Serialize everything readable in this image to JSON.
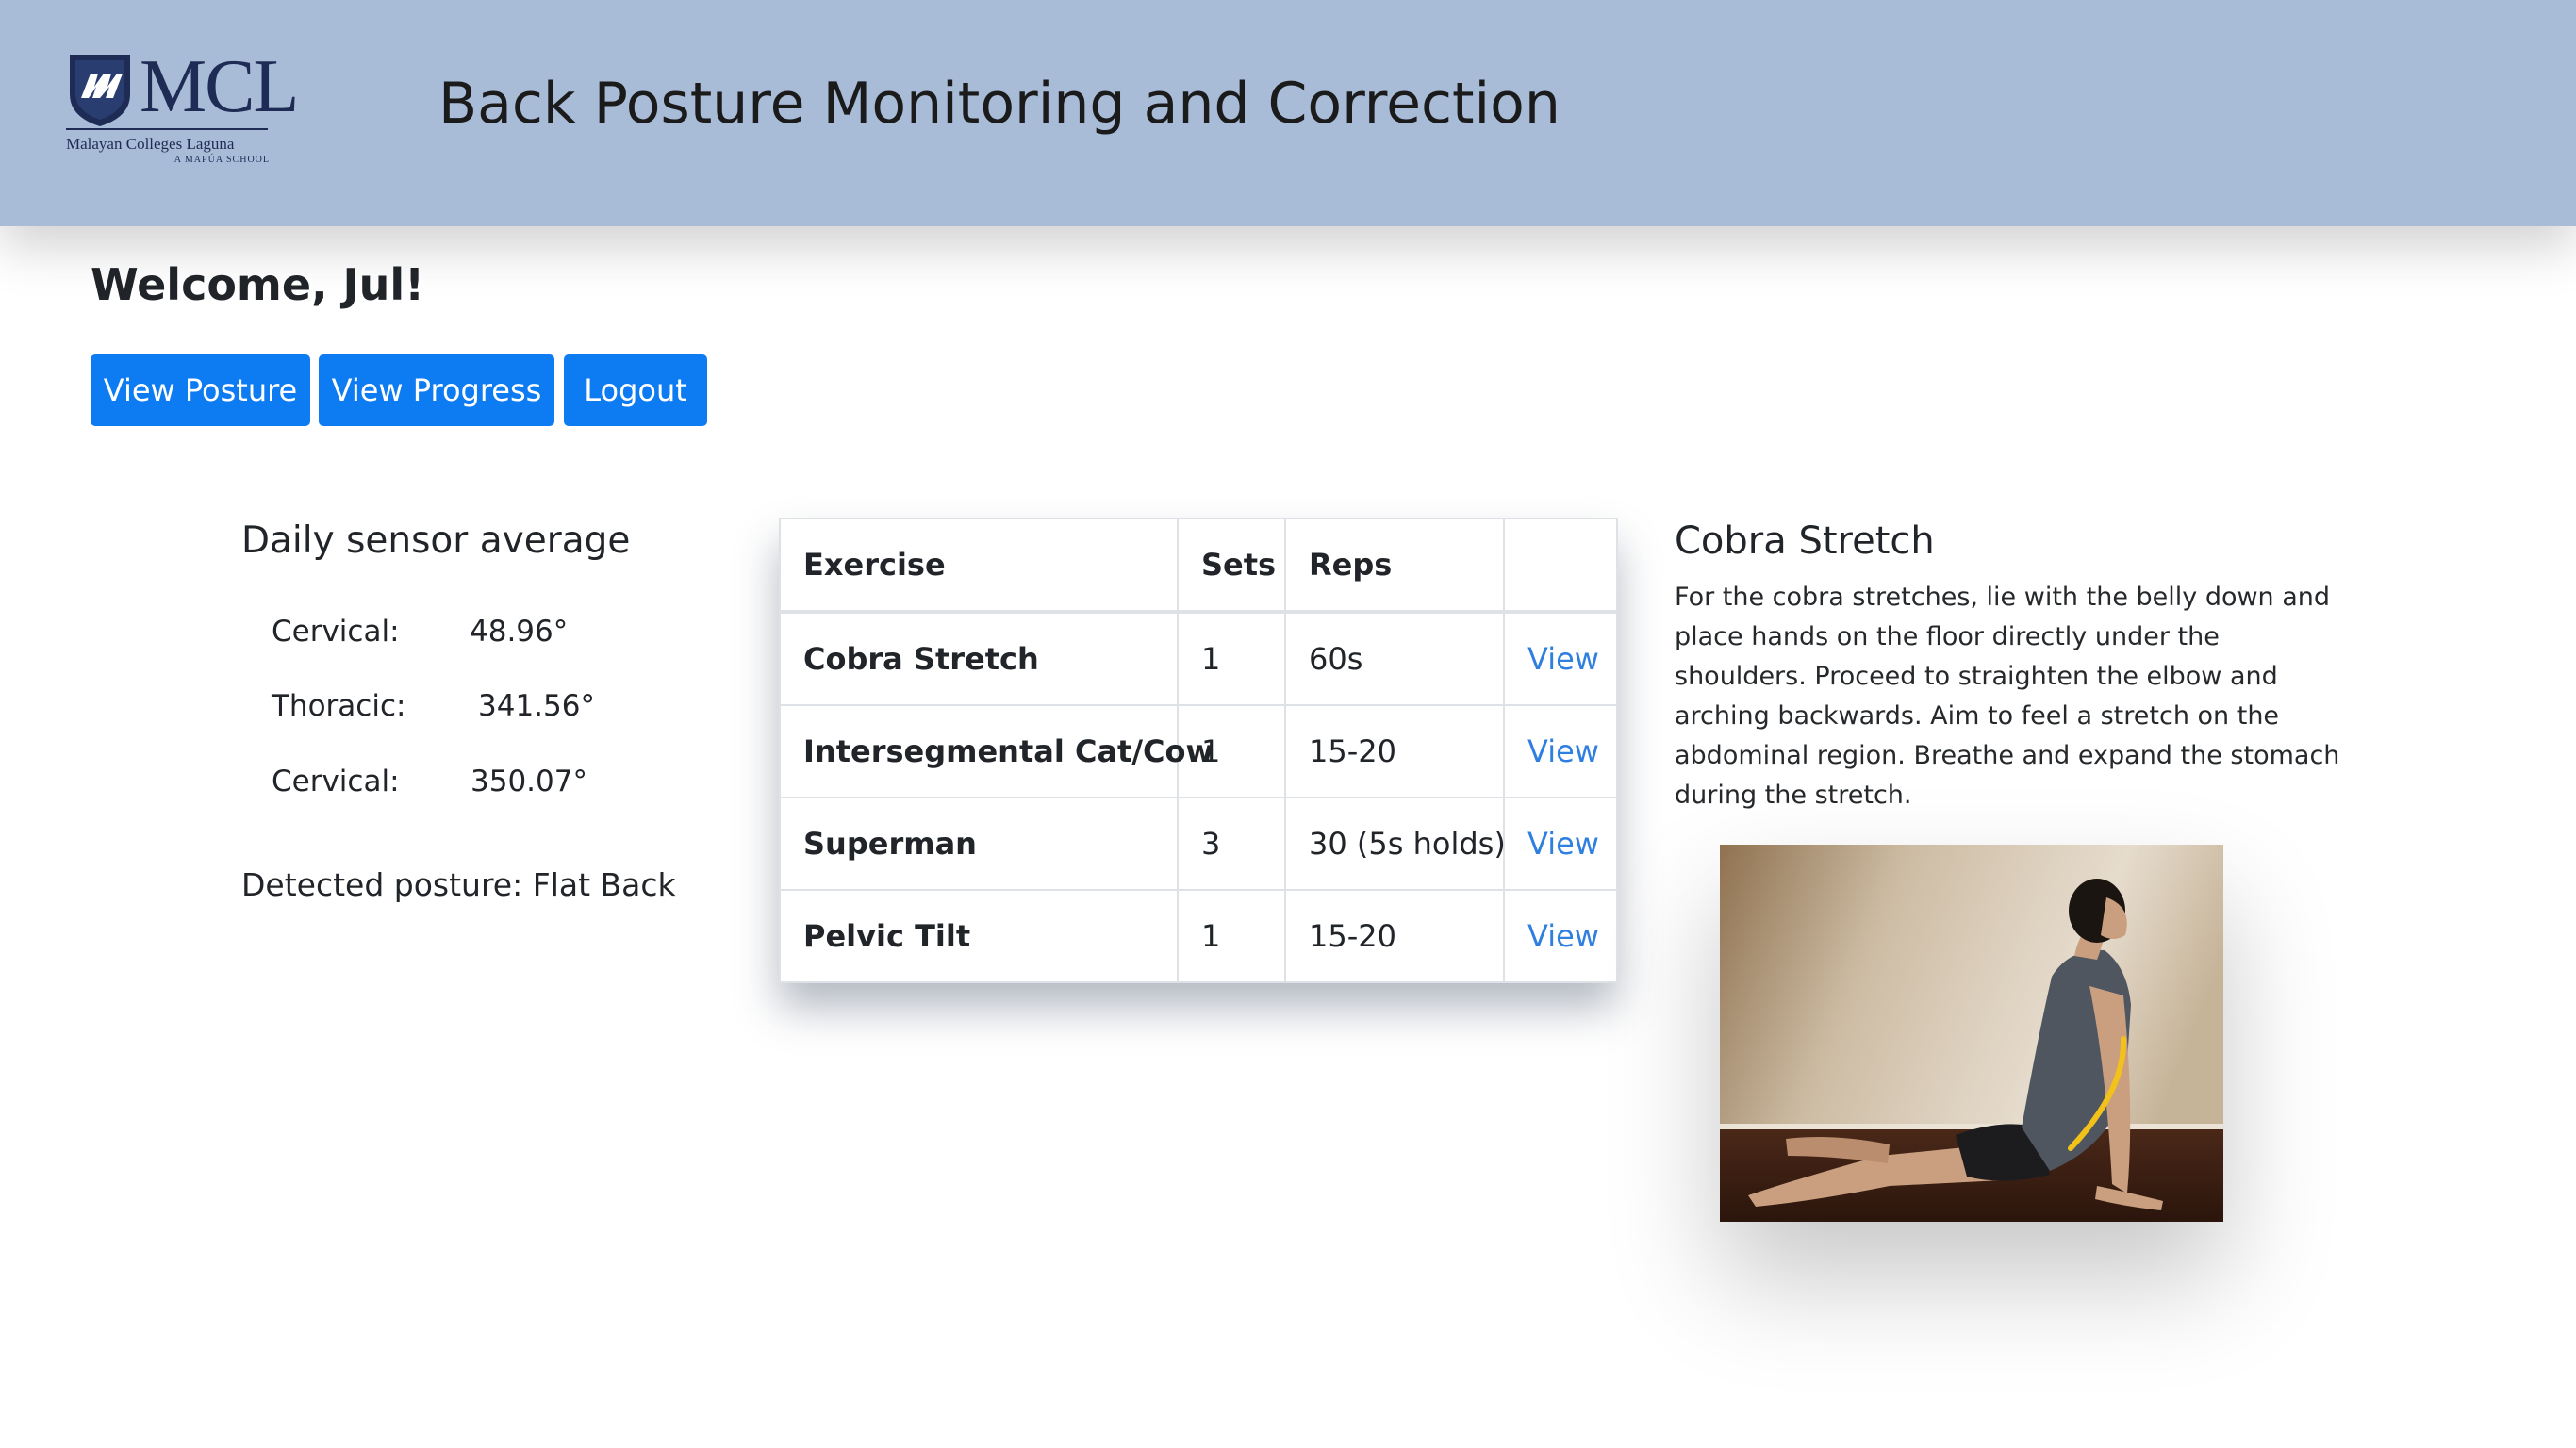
{
  "header": {
    "logo": {
      "text": "MCL",
      "subtitle": "Malayan Colleges Laguna",
      "tagline": "A MAPÚA SCHOOL"
    },
    "title": "Back Posture Monitoring and Correction",
    "background_color": "#a8bcd8"
  },
  "welcome": "Welcome, Jul!",
  "nav": {
    "view_posture": "View Posture",
    "view_progress": "View Progress",
    "logout": "Logout",
    "button_color": "#0d7bf2"
  },
  "sensor": {
    "title": "Daily sensor average",
    "readings": [
      {
        "label": "Cervical:",
        "value": "48.96°"
      },
      {
        "label": "Thoracic:",
        "value": "341.56°"
      },
      {
        "label": "Cervical:",
        "value": "350.07°"
      }
    ],
    "detected_label": "Detected posture:",
    "detected_value": "Flat Back"
  },
  "exercises": {
    "headers": [
      "Exercise",
      "Sets",
      "Reps",
      ""
    ],
    "rows": [
      {
        "name": "Cobra Stretch",
        "sets": "1",
        "reps": "60s",
        "action": "View"
      },
      {
        "name": "Intersegmental Cat/Cow",
        "sets": "1",
        "reps": "15-20",
        "action": "View"
      },
      {
        "name": "Superman",
        "sets": "3",
        "reps": "30 (5s holds)",
        "action": "View"
      },
      {
        "name": "Pelvic Tilt",
        "sets": "1",
        "reps": "15-20",
        "action": "View"
      }
    ],
    "link_color": "#2f7fe0"
  },
  "detail": {
    "title": "Cobra Stretch",
    "description": "For the cobra stretches, lie with the belly down and place hands on the floor directly under the shoulders. Proceed to straighten the elbow and arching backwards. Aim to feel a stretch on the abdominal region. Breathe and expand the stomach during the stretch.",
    "image": "cobra-stretch-photo",
    "spine_highlight_color": "#f2c21b"
  }
}
